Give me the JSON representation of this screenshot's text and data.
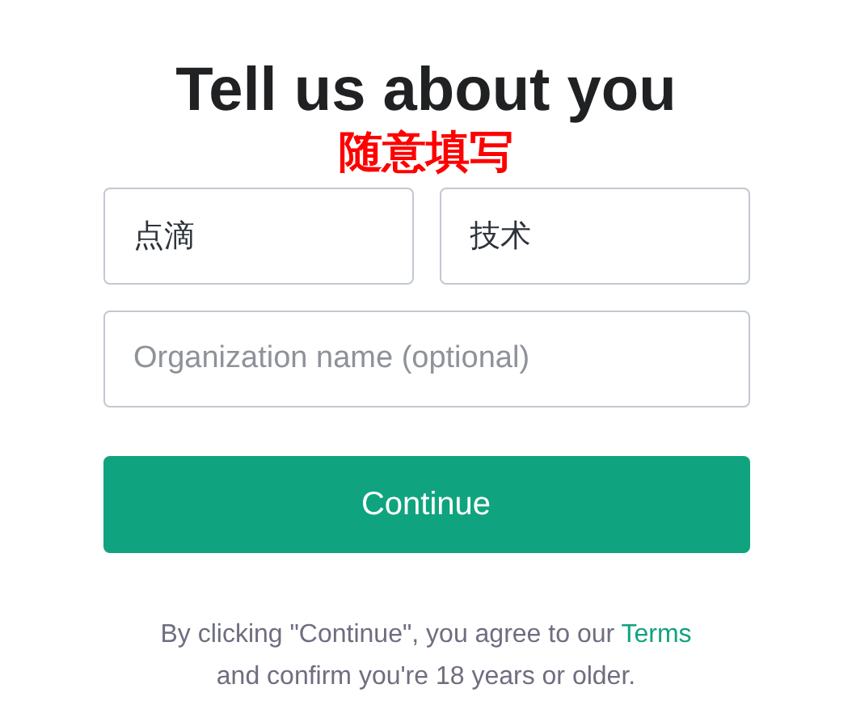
{
  "title": "Tell us about you",
  "annotation": "随意填写",
  "fields": [
    {
      "value": "点滴"
    },
    {
      "value": "技术"
    },
    {
      "placeholder": "Organization name (optional)"
    }
  ],
  "continue_button": "Continue",
  "legal": {
    "text": "By clicking \"Continue\", you agree to our",
    "link": "Terms",
    "text_after": "and confirm you're 18 years or older."
  }
}
